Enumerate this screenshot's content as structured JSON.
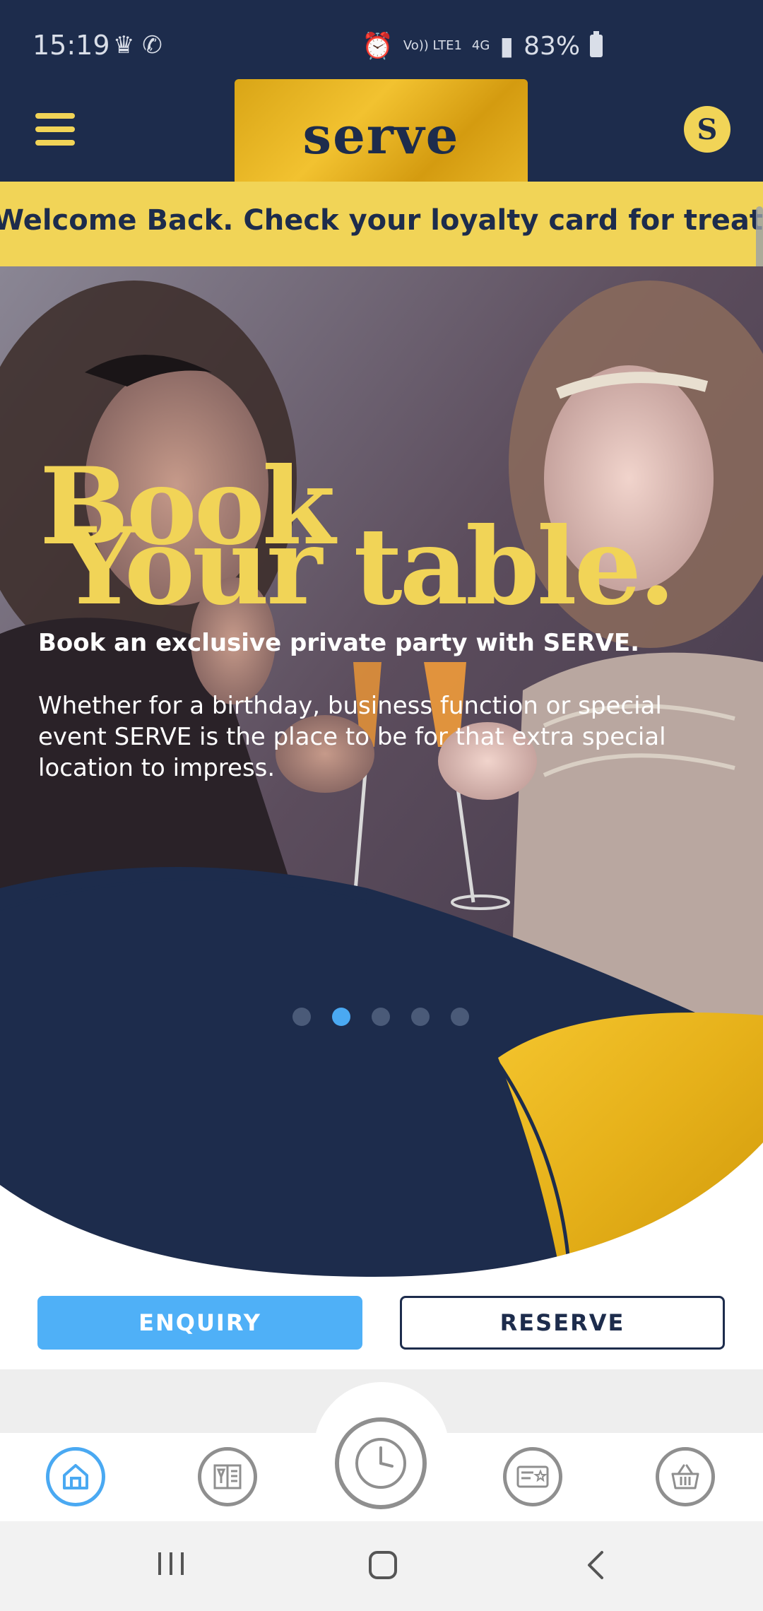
{
  "status_bar": {
    "time": "15:19",
    "left_icons": [
      "crown-icon",
      "whatsapp-icon"
    ],
    "right_icons": [
      "alarm-icon",
      "volte-icon",
      "4g-icon",
      "signal-icon"
    ],
    "volte_label": "Vo)) LTE1",
    "network_label": "4G",
    "battery_percent": "83%"
  },
  "header": {
    "logo_text": "serve",
    "badge_letter": "S"
  },
  "ticker": {
    "text": "Welcome Back. Check your loyalty card for treats"
  },
  "hero": {
    "headline_line1": "Book",
    "headline_line2": "Your table.",
    "subhead": "Book an exclusive private party with SERVE.",
    "body": "Whether for a birthday, business function or special event SERVE is the place to be for that extra special location to impress.",
    "carousel": {
      "count": 5,
      "active_index": 1
    }
  },
  "actions": {
    "enquiry_label": "ENQUIRY",
    "reserve_label": "RESERVE"
  },
  "bottom_nav": {
    "items": [
      "home-icon",
      "menu-drinks-icon",
      "clock-icon",
      "loyalty-card-icon",
      "basket-icon"
    ],
    "active": "home-icon"
  },
  "colors": {
    "navy": "#1d2c4c",
    "yellow": "#f1d457",
    "gold": "#e3b21e",
    "accent_blue": "#4fb0f7"
  }
}
